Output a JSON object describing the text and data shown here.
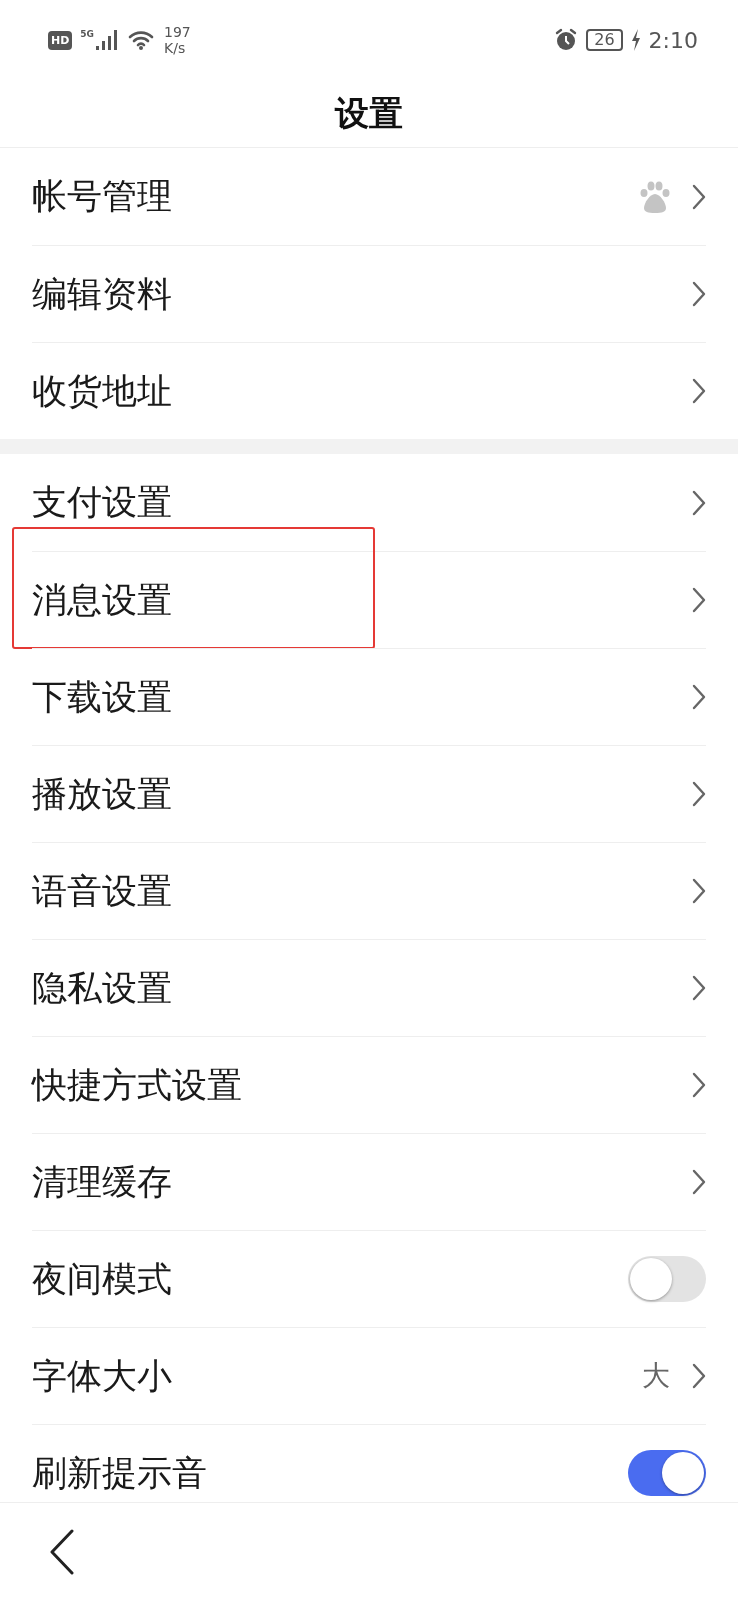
{
  "status_bar": {
    "hd_label": "HD",
    "signal_label": "5G",
    "network_speed": "197",
    "network_speed_unit": "K/s",
    "battery": "26",
    "time": "2:10"
  },
  "title": "设置",
  "groups": [
    {
      "items": [
        {
          "label": "帐号管理",
          "kind": "account",
          "highlighted": false
        },
        {
          "label": "编辑资料",
          "kind": "link",
          "highlighted": false
        },
        {
          "label": "收货地址",
          "kind": "link",
          "highlighted": false
        }
      ]
    },
    {
      "items": [
        {
          "label": "支付设置",
          "kind": "link",
          "highlighted": false
        },
        {
          "label": "消息设置",
          "kind": "link",
          "highlighted": true
        },
        {
          "label": "下载设置",
          "kind": "link",
          "highlighted": false
        },
        {
          "label": "播放设置",
          "kind": "link",
          "highlighted": false
        },
        {
          "label": "语音设置",
          "kind": "link",
          "highlighted": false
        },
        {
          "label": "隐私设置",
          "kind": "link",
          "highlighted": false
        },
        {
          "label": "快捷方式设置",
          "kind": "link",
          "highlighted": false
        },
        {
          "label": "清理缓存",
          "kind": "link",
          "highlighted": false
        },
        {
          "label": "夜间模式",
          "kind": "toggle",
          "on": false,
          "highlighted": false
        },
        {
          "label": "字体大小",
          "kind": "value",
          "value": "大",
          "highlighted": false
        },
        {
          "label": "刷新提示音",
          "kind": "toggle",
          "on": true,
          "highlighted": false
        }
      ]
    }
  ]
}
